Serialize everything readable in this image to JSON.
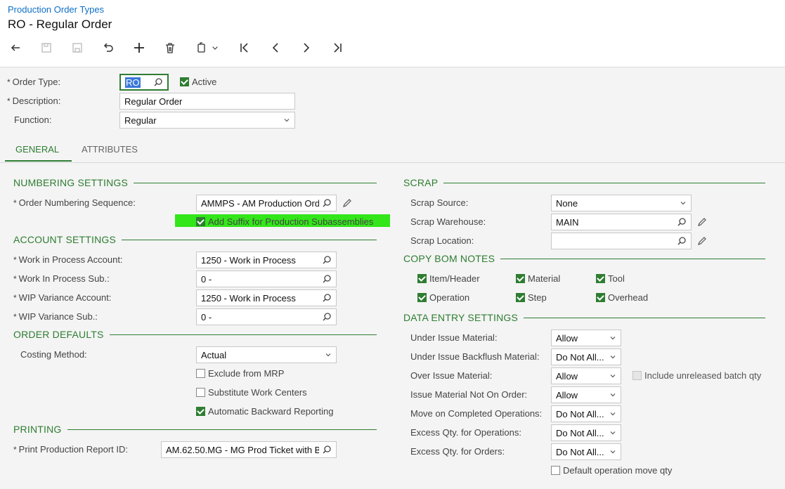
{
  "breadcrumb": "Production Order Types",
  "title": "RO - Regular Order",
  "toolbar": [
    "back-icon",
    "save-close-icon",
    "save-icon",
    "undo-icon",
    "add-icon",
    "delete-icon",
    "copy-paste-icon",
    "first-icon",
    "previous-icon",
    "next-icon",
    "last-icon"
  ],
  "header": {
    "order_type_label": "Order Type:",
    "order_type_value": "RO",
    "active_label": "Active",
    "description_label": "Description:",
    "description_value": "Regular Order",
    "function_label": "Function:",
    "function_value": "Regular"
  },
  "tabs": {
    "general": "GENERAL",
    "attributes": "ATTRIBUTES"
  },
  "numbering": {
    "title": "NUMBERING SETTINGS",
    "seq_label": "Order Numbering Sequence:",
    "seq_value": "AMMPS - AM Production Ord",
    "suffix_label": "Add Suffix for Production Subassemblies"
  },
  "account": {
    "title": "ACCOUNT SETTINGS",
    "wip_account_label": "Work in Process Account:",
    "wip_account_value": "1250 - Work in Process",
    "wip_sub_label": "Work In Process Sub.:",
    "wip_sub_value": "0 -",
    "wip_var_account_label": "WIP Variance Account:",
    "wip_var_account_value": "1250 - Work in Process",
    "wip_var_sub_label": "WIP Variance Sub.:",
    "wip_var_sub_value": "0 -"
  },
  "defaults": {
    "title": "ORDER DEFAULTS",
    "costing_label": "Costing Method:",
    "costing_value": "Actual",
    "exclude_mrp": "Exclude from MRP",
    "substitute_wc": "Substitute Work Centers",
    "auto_backward": "Automatic Backward Reporting"
  },
  "printing": {
    "title": "PRINTING",
    "report_label": "Print Production Report ID:",
    "report_value": "AM.62.50.MG - MG Prod Ticket with B"
  },
  "scrap": {
    "title": "SCRAP",
    "source_label": "Scrap Source:",
    "source_value": "None",
    "warehouse_label": "Scrap Warehouse:",
    "warehouse_value": "MAIN",
    "location_label": "Scrap Location:",
    "location_value": ""
  },
  "bom_notes": {
    "title": "COPY BOM NOTES",
    "item_header": "Item/Header",
    "material": "Material",
    "tool": "Tool",
    "operation": "Operation",
    "step": "Step",
    "overhead": "Overhead"
  },
  "data_entry": {
    "title": "DATA ENTRY SETTINGS",
    "under_issue_label": "Under Issue Material:",
    "under_issue_value": "Allow",
    "under_backflush_label": "Under Issue Backflush Material:",
    "under_backflush_value": "Do Not All...",
    "over_issue_label": "Over Issue Material:",
    "over_issue_value": "Allow",
    "include_unreleased": "Include unreleased batch qty",
    "not_on_order_label": "Issue Material Not On Order:",
    "not_on_order_value": "Allow",
    "move_completed_label": "Move on Completed Operations:",
    "move_completed_value": "Do Not All...",
    "excess_ops_label": "Excess Qty. for Operations:",
    "excess_ops_value": "Do Not All...",
    "excess_orders_label": "Excess Qty. for Orders:",
    "excess_orders_value": "Do Not All...",
    "default_move_qty": "Default operation move qty"
  },
  "colors": {
    "accent": "#2e7d32",
    "link": "#0f6fc6",
    "highlight": "#33e61a"
  }
}
